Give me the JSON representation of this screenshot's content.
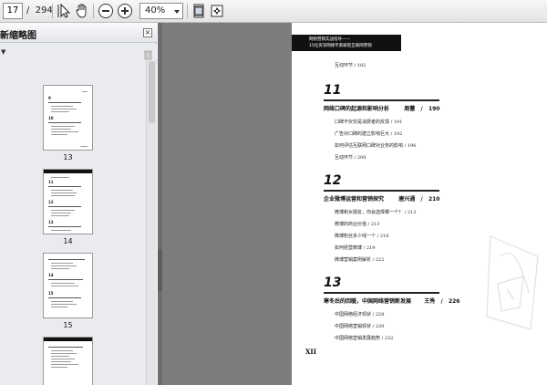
{
  "toolbar": {
    "current_page": "17",
    "total_pages": "/  294",
    "zoom": "40%",
    "icons": [
      "select-arrow-icon",
      "hand-tool-icon",
      "zoom-out-icon",
      "zoom-in-icon",
      "zoom-dropdown-icon",
      "fit-page-icon",
      "fit-width-icon"
    ]
  },
  "panel": {
    "title": "新缩略图",
    "close": "×",
    "icons": [
      "options-arrow-icon",
      "trash-icon"
    ],
    "thumbnails": [
      {
        "label": "13"
      },
      {
        "label": "14"
      },
      {
        "label": "15"
      },
      {
        "label": ""
      }
    ]
  },
  "page": {
    "banner_line1": "网络营销实战指导——",
    "banner_line2": "15位资深网络专家解密互联网营销",
    "top_entry": "互动环节  /  182",
    "roman_page": "XII",
    "chapters": [
      {
        "number": "11",
        "title": "网络口碑的起源和影响分析",
        "author": "周蕾",
        "page": "190",
        "entries": [
          "口碑不仅仅是消费者的反馈  /  191",
          "广告对口碑的建立影响巨大  /  192",
          "如何评估互联网口碑对业务的影响  /  196",
          "互动环节  /  200"
        ]
      },
      {
        "number": "12",
        "title": "企业微博运营和营销探究",
        "author": "唐兴通",
        "page": "210",
        "entries": [
          "微博和女朋友，你会选择哪一个？  /  213",
          "微博的商业价值  /  213",
          "微博粉丝多少线一个  /  218",
          "如何经营微博  /  219",
          "微博营销案例解析  /  222"
        ]
      },
      {
        "number": "13",
        "title": "寒冬后的回暖，中国网络营销新发展",
        "author": "王秀",
        "page": "226",
        "entries": [
          "中国网络经济现状  /  228",
          "中国网络营销现状  /  230",
          "中国网络营销发展趋势  /  232"
        ]
      }
    ]
  }
}
